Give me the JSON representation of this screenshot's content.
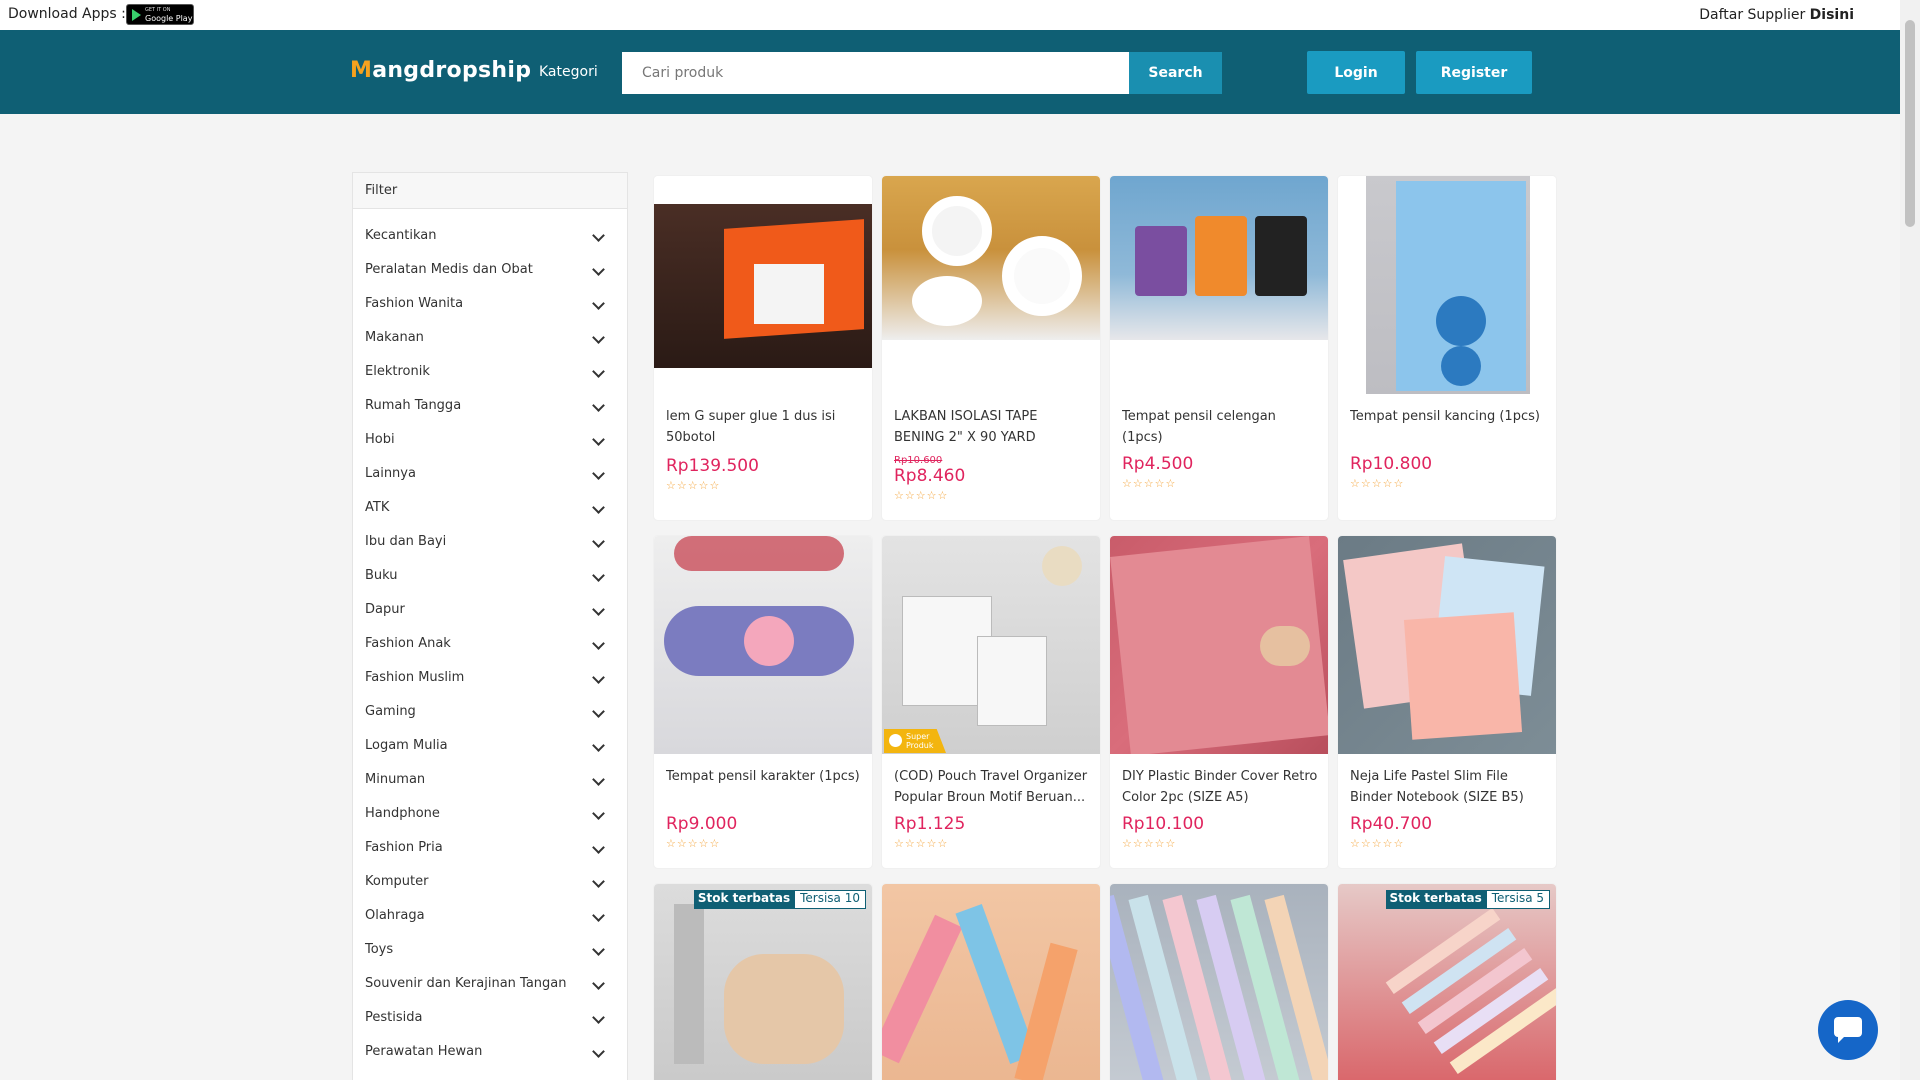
{
  "topbar": {
    "download_label": "Download Apps :",
    "google_play_small": "GET IT ON",
    "google_play_label": "Google Play",
    "supplier_text": "Daftar Supplier",
    "supplier_link": "Disini"
  },
  "header": {
    "logo_m": "M",
    "logo_rest": "angdropship",
    "kategori_label": "Kategori",
    "search_placeholder": "Cari produk",
    "search_value": "",
    "search_button": "Search",
    "login_button": "Login",
    "register_button": "Register"
  },
  "filter": {
    "title": "Filter",
    "categories": [
      "Kecantikan",
      "Peralatan Medis dan Obat",
      "Fashion Wanita",
      "Makanan",
      "Elektronik",
      "Rumah Tangga",
      "Hobi",
      "Lainnya",
      "ATK",
      "Ibu dan Bayi",
      "Buku",
      "Dapur",
      "Fashion Anak",
      "Fashion Muslim",
      "Gaming",
      "Logam Mulia",
      "Minuman",
      "Handphone",
      "Fashion Pria",
      "Komputer",
      "Olahraga",
      "Toys",
      "Souvenir dan Kerajinan Tangan",
      "Pestisida",
      "Perawatan Hewan"
    ]
  },
  "products": [
    {
      "name": "lem G super glue 1 dus isi 50botol",
      "price": "Rp139.500",
      "old_price": "",
      "rating": "☆☆☆☆☆",
      "image": "orange-glue-box",
      "badge": null,
      "super": false
    },
    {
      "name": "LAKBAN ISOLASI TAPE BENING 2\" X 90 YARD",
      "price": "Rp8.460",
      "old_price": "Rp10.600",
      "rating": "☆☆☆☆☆",
      "image": "clear-tape-rolls",
      "badge": null,
      "super": false
    },
    {
      "name": "Tempat pensil celengan (1pcs)",
      "price": "Rp4.500",
      "old_price": "",
      "rating": "☆☆☆☆☆",
      "image": "character-pencil-cups",
      "badge": null,
      "super": false
    },
    {
      "name": "Tempat pensil kancing (1pcs)",
      "price": "Rp10.800",
      "old_price": "",
      "rating": "☆☆☆☆☆",
      "image": "blue-pencil-pouch",
      "badge": null,
      "super": false
    },
    {
      "name": "Tempat pensil karakter (1pcs)",
      "price": "Rp9.000",
      "old_price": "",
      "rating": "☆☆☆☆☆",
      "image": "flower-pencil-pouch",
      "badge": null,
      "super": false
    },
    {
      "name": "(COD) Pouch Travel Organizer Popular Broun Motif Beruan...",
      "price": "Rp1.125",
      "old_price": "",
      "rating": "☆☆☆☆☆",
      "image": "drawstring-pouches",
      "badge": null,
      "super": true,
      "super_label_1": "Super",
      "super_label_2": "Produk"
    },
    {
      "name": "DIY Plastic Binder Cover Retro Color 2pc (SIZE A5)",
      "price": "Rp10.100",
      "old_price": "",
      "rating": "☆☆☆☆☆",
      "image": "pink-binder-cover",
      "badge": null,
      "super": false
    },
    {
      "name": "Neja Life Pastel Slim File Binder Notebook (SIZE B5)",
      "price": "Rp40.700",
      "old_price": "",
      "rating": "☆☆☆☆☆",
      "image": "pastel-notebooks",
      "badge": null,
      "super": false
    },
    {
      "name": "",
      "price": "",
      "old_price": "",
      "rating": "",
      "image": "binder-rings-hand",
      "badge": {
        "label": "Stok terbatas",
        "remaining": "Tersisa 10"
      },
      "super": false
    },
    {
      "name": "",
      "price": "",
      "old_price": "",
      "rating": "",
      "image": "pastel-highlighters",
      "badge": null,
      "super": false
    },
    {
      "name": "",
      "price": "",
      "old_price": "",
      "rating": "",
      "image": "binder-spines",
      "badge": null,
      "super": false
    },
    {
      "name": "",
      "price": "",
      "old_price": "",
      "rating": "",
      "image": "sticky-note-strips",
      "badge": {
        "label": "Stok terbatas",
        "remaining": "Tersisa 5"
      },
      "super": false
    }
  ],
  "chat": {
    "icon": "chat-icon"
  },
  "colors": {
    "header_bg": "#0f5f74",
    "button_bg": "#1a9bc1",
    "price": "#e0245e",
    "star": "#f4a53c"
  }
}
